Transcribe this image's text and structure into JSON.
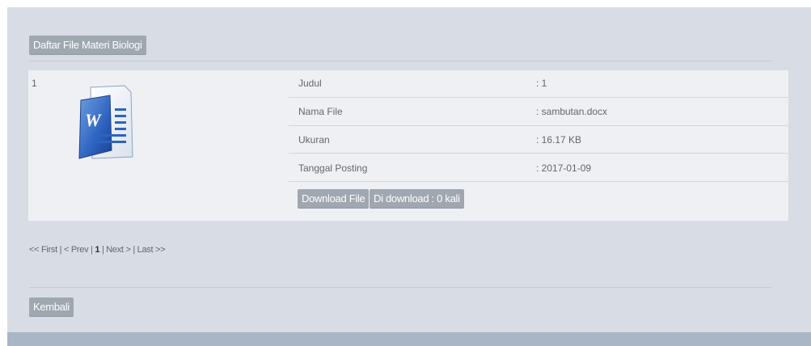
{
  "section_title": "Daftar File Materi Biologi",
  "file": {
    "index": "1",
    "icon": "word-document-icon",
    "rows": [
      {
        "label": "Judul",
        "value": ": 1"
      },
      {
        "label": "Nama File",
        "value": ": sambutan.docx"
      },
      {
        "label": "Ukuran",
        "value": ": 16.17 KB"
      },
      {
        "label": "Tanggal Posting",
        "value": ": 2017-01-09"
      }
    ],
    "download_label": "Download File",
    "download_count_label": "Di download : 0 kali"
  },
  "pagination": {
    "first": "<< First",
    "prev": "< Prev",
    "current": "1",
    "next": "Next >",
    "last": "Last >>",
    "separator": " | "
  },
  "back_label": "Kembali",
  "colors": {
    "panel_bg": "#d8dde5",
    "button_bg": "#9fa7b0",
    "footer_bar": "#a9b6c6"
  }
}
